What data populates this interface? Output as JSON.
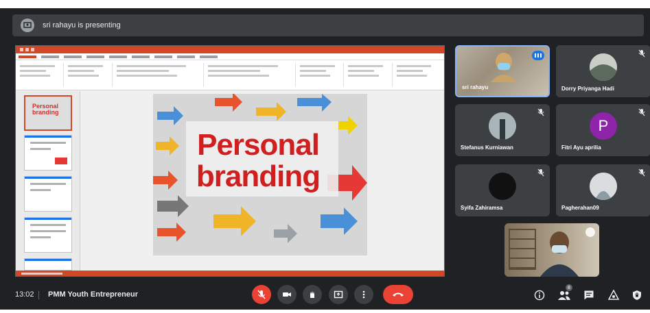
{
  "banner": {
    "text": "sri rahayu is presenting",
    "icon": "present-icon"
  },
  "presentation": {
    "app": "PowerPoint",
    "slide_title_line1": "Personal",
    "slide_title_line2": "branding",
    "thumb_title_line1": "Personal",
    "thumb_title_line2": "branding"
  },
  "participants": [
    {
      "name": "sri rahayu",
      "type": "video",
      "speaking": true
    },
    {
      "name": "Dorry Priyanga Hadi",
      "type": "avatar-photo",
      "muted": true
    },
    {
      "name": "Stefanus Kurniawan",
      "type": "avatar-photo",
      "muted": true
    },
    {
      "name": "Fitri Ayu aprilia",
      "type": "initial",
      "initial": "P",
      "color": "#8e24aa",
      "muted": true
    },
    {
      "name": "Syifa Zahiramsa",
      "type": "avatar-photo",
      "muted": true
    },
    {
      "name": "Pagherahan09",
      "type": "avatar-photo",
      "muted": true
    }
  ],
  "bottom": {
    "time": "13:02",
    "meeting_name": "PMM Youth Entrepreneur",
    "participant_count": "8"
  },
  "colors": {
    "accent": "#1a73e8",
    "end_call": "#ea4335",
    "ppt": "#d24726",
    "slide_red": "#d01f1f"
  }
}
